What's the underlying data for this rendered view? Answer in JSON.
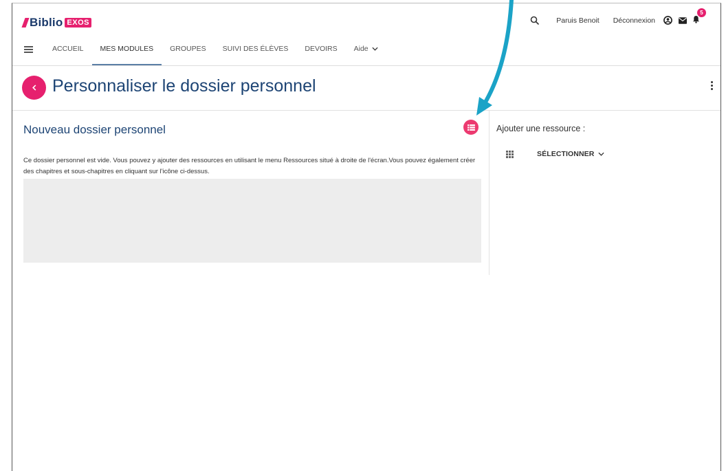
{
  "brand": {
    "name": "Biblio",
    "badge": "EXOS",
    "accent": "#e6206e",
    "primary": "#1d4474"
  },
  "header": {
    "user_name": "Paruis Benoit",
    "logout_label": "Déconnexion",
    "notification_count": "5",
    "icons": [
      "search-icon",
      "account-icon",
      "mail-icon",
      "bell-icon"
    ]
  },
  "nav": {
    "items": [
      {
        "label": "ACCUEIL"
      },
      {
        "label": "MES MODULES",
        "active": true
      },
      {
        "label": "GROUPES"
      },
      {
        "label": "SUIVI DES ÉLÈVES"
      },
      {
        "label": "DEVOIRS"
      },
      {
        "label": "Aide"
      }
    ]
  },
  "page": {
    "title": "Personnaliser le dossier personnel",
    "back_icon": "chevron-left-icon"
  },
  "folder": {
    "title": "Nouveau dossier personnel",
    "empty_message": "Ce dossier personnel est vide. Vous pouvez y ajouter des ressources en utilisant le menu Ressources situé à droite de l'écran.Vous pouvez également créer des chapitres et sous-chapitres en cliquant sur l'icône ci-dessus.",
    "add_icon": "list-add-icon"
  },
  "resources": {
    "title": "Ajouter une ressource :",
    "select_label": "SÉLECTIONNER"
  },
  "annotation": {
    "arrow_color": "#1ba3c7"
  }
}
